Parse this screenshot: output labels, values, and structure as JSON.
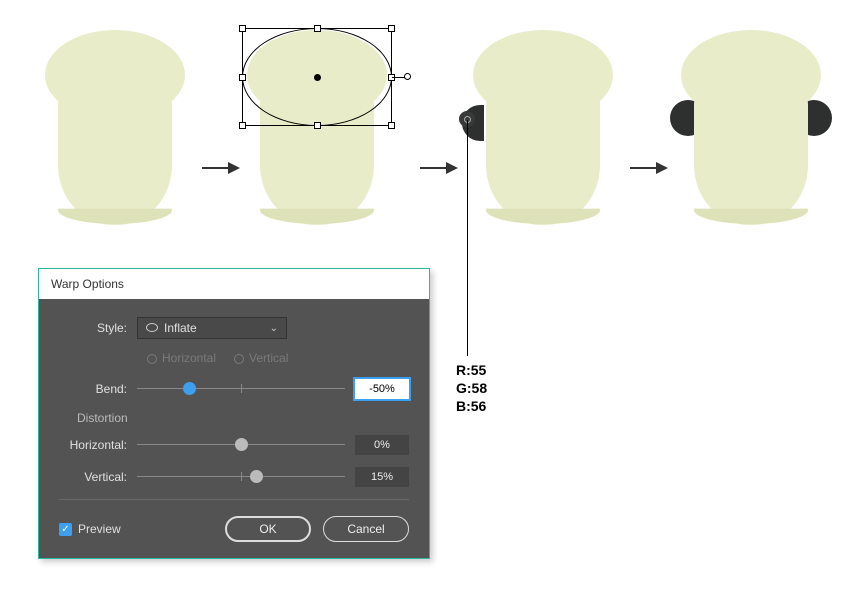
{
  "dialog": {
    "title": "Warp Options",
    "style_label": "Style:",
    "style_value": "Inflate",
    "orientation": {
      "horizontal": "Horizontal",
      "vertical": "Vertical"
    },
    "bend": {
      "label": "Bend:",
      "value": "-50%",
      "pos": 25
    },
    "distortion_label": "Distortion",
    "distortion_h": {
      "label": "Horizontal:",
      "value": "0%",
      "pos": 50
    },
    "distortion_v": {
      "label": "Vertical:",
      "value": "15%",
      "pos": 57
    },
    "preview_label": "Preview",
    "preview_checked": true,
    "ok_label": "OK",
    "cancel_label": "Cancel"
  },
  "rgb": {
    "r_label": "R:55",
    "g_label": "G:58",
    "b_label": "B:56"
  },
  "colors": {
    "shape": "#e9ecc9",
    "ear": "#373a38"
  }
}
